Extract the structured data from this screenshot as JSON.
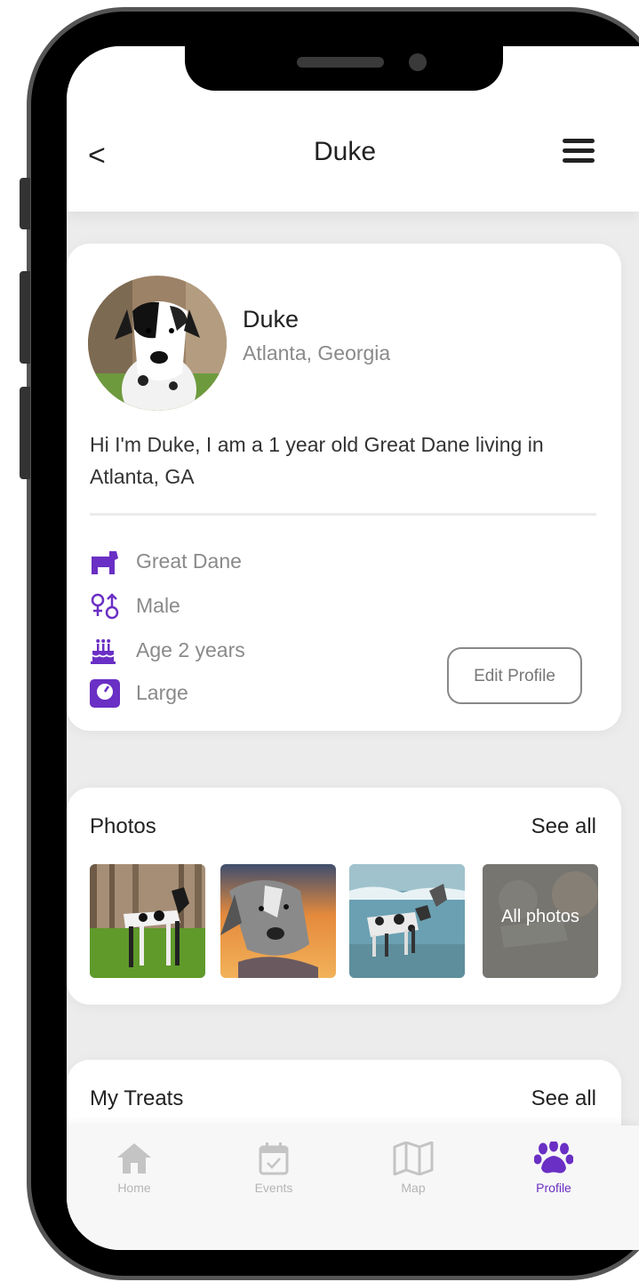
{
  "header": {
    "back_label": "<",
    "title": "Duke"
  },
  "profile": {
    "name": "Duke",
    "location": "Atlanta, Georgia",
    "bio": "Hi I'm Duke, I am a 1 year old Great Dane living in Atlanta, GA",
    "attributes": [
      {
        "icon": "dog-icon",
        "label": "Great Dane"
      },
      {
        "icon": "gender-icon",
        "label": "Male"
      },
      {
        "icon": "birthday-cake-icon",
        "label": "Age 2 years"
      },
      {
        "icon": "scale-icon",
        "label": "Large"
      }
    ],
    "edit_label": "Edit Profile"
  },
  "photos": {
    "title": "Photos",
    "see_all": "See all",
    "all_photos_label": "All photos"
  },
  "treats": {
    "title": "My Treats",
    "see_all": "See all"
  },
  "tabbar": {
    "items": [
      {
        "label": "Home",
        "icon": "home-icon"
      },
      {
        "label": "Events",
        "icon": "calendar-icon"
      },
      {
        "label": "Map",
        "icon": "map-icon"
      },
      {
        "label": "Profile",
        "icon": "paw-icon"
      }
    ]
  },
  "colors": {
    "accent": "#6a2fc4",
    "muted": "#8a8a8a",
    "background": "#ececec"
  }
}
